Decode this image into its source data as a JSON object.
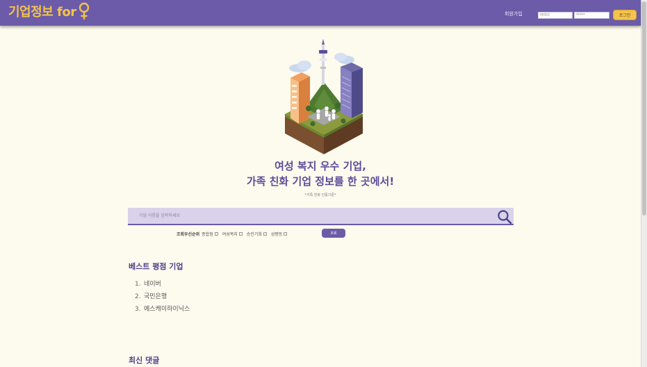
{
  "header": {
    "logo_text": "기업정보 for",
    "signup_link": "회원가입",
    "id_placeholder": "아이디",
    "password_placeholder": "*****",
    "login_button": "로그인",
    "accent_color": "#6b5ba8",
    "logo_color": "#f4c34c"
  },
  "hero": {
    "headline_line1": "여성 복지 우수 기업,",
    "headline_line2": "가족 친화 기업 정보를 한 곳에서!",
    "subtext": "*가족 친화 인증기준*"
  },
  "search": {
    "placeholder": "기업 이름을 입력하세요",
    "icon": "search-icon"
  },
  "filters": {
    "label": "조회우선순위",
    "items": [
      {
        "label": "종합점"
      },
      {
        "label": "여성복지"
      },
      {
        "label": "승진기회"
      },
      {
        "label": "성평등"
      }
    ],
    "submit_label": "조회"
  },
  "best_rated": {
    "title": "베스트 평점 기업",
    "items": [
      {
        "rank": "1.",
        "name": "네이버"
      },
      {
        "rank": "2.",
        "name": "국민은행"
      },
      {
        "rank": "3.",
        "name": "에스케이하이닉스"
      }
    ]
  },
  "recent_comments": {
    "title": "최신 댓글"
  }
}
